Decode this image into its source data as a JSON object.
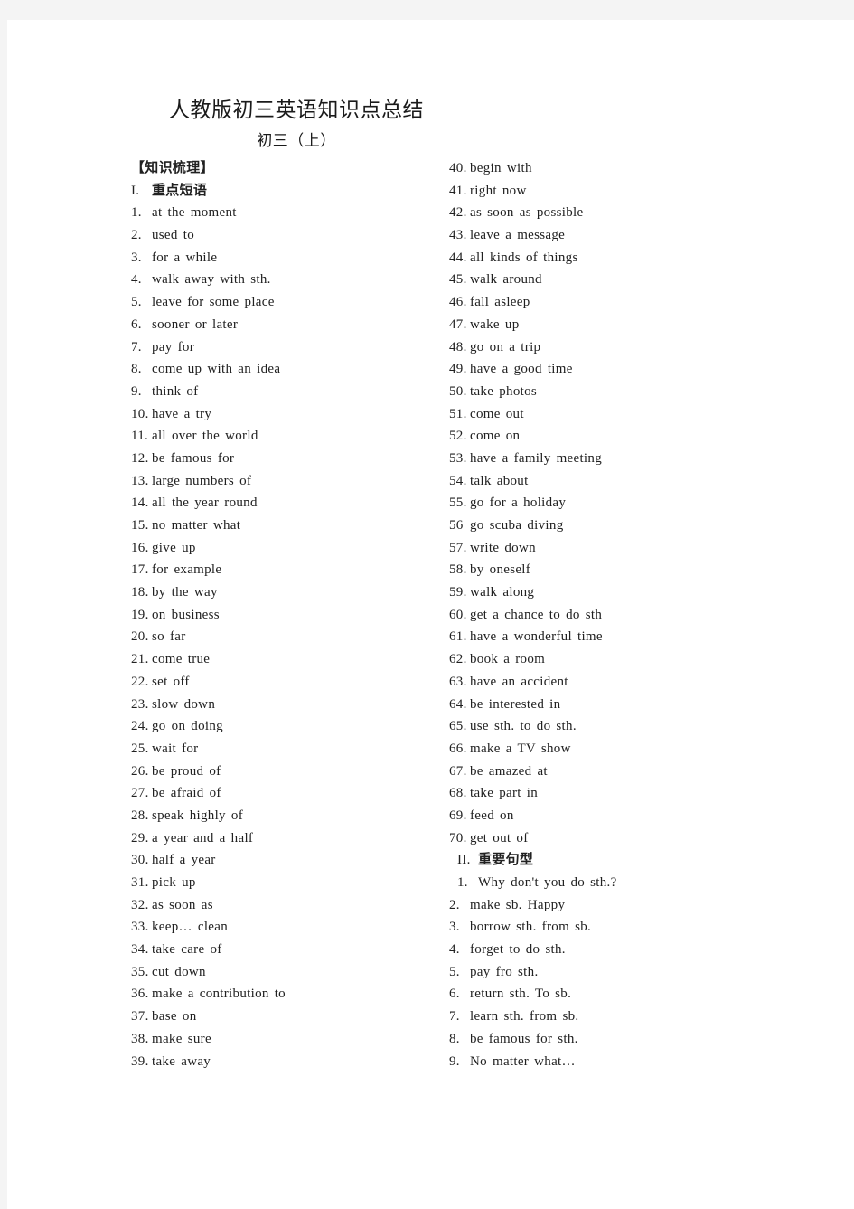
{
  "document": {
    "title": "人教版初三英语知识点总结",
    "subtitle": "初三（上）",
    "outline_heading": "【知识梳理】"
  },
  "sections": [
    {
      "number": "I.",
      "heading": "重点短语",
      "items": [
        {
          "num": "1.",
          "text": "at the moment"
        },
        {
          "num": "2.",
          "text": "used to"
        },
        {
          "num": "3.",
          "text": "for a while"
        },
        {
          "num": "4.",
          "text": "walk away with sth."
        },
        {
          "num": "5.",
          "text": "leave for some place"
        },
        {
          "num": "6.",
          "text": "sooner or later"
        },
        {
          "num": "7.",
          "text": "pay for"
        },
        {
          "num": "8.",
          "text": "come up with an idea"
        },
        {
          "num": "9.",
          "text": "think of"
        },
        {
          "num": "10.",
          "text": "have a try"
        },
        {
          "num": "11.",
          "text": "all over the world"
        },
        {
          "num": "12.",
          "text": "be famous for"
        },
        {
          "num": "13.",
          "text": "large numbers of"
        },
        {
          "num": "14.",
          "text": "all the year round"
        },
        {
          "num": "15.",
          "text": "no matter what"
        },
        {
          "num": "16.",
          "text": "give up"
        },
        {
          "num": "17.",
          "text": "for example"
        },
        {
          "num": "18.",
          "text": "by the way"
        },
        {
          "num": "19.",
          "text": "on business"
        },
        {
          "num": "20.",
          "text": "so far"
        },
        {
          "num": "21.",
          "text": "come true"
        },
        {
          "num": "22.",
          "text": "set off"
        },
        {
          "num": "23.",
          "text": "slow down"
        },
        {
          "num": "24.",
          "text": "go on doing"
        },
        {
          "num": "25.",
          "text": "wait for"
        },
        {
          "num": "26.",
          "text": "be proud of"
        },
        {
          "num": "27.",
          "text": "be afraid of"
        },
        {
          "num": "28.",
          "text": "speak highly of"
        },
        {
          "num": "29.",
          "text": "a year and a half"
        },
        {
          "num": "30.",
          "text": "half a year"
        },
        {
          "num": "31.",
          "text": "pick up"
        },
        {
          "num": "32.",
          "text": "as soon as"
        },
        {
          "num": "33.",
          "text": "keep… clean"
        },
        {
          "num": "34.",
          "text": "take care of"
        },
        {
          "num": "35.",
          "text": "cut down"
        },
        {
          "num": "36.",
          "text": "make a contribution to"
        },
        {
          "num": "37.",
          "text": "base on"
        },
        {
          "num": "38.",
          "text": "make sure"
        },
        {
          "num": "39.",
          "text": "take away"
        },
        {
          "num": "40.",
          "text": "begin with"
        },
        {
          "num": "41.",
          "text": "right now"
        },
        {
          "num": "42.",
          "text": "as soon as possible"
        },
        {
          "num": "43.",
          "text": "leave a message"
        },
        {
          "num": "44.",
          "text": "all kinds of things"
        },
        {
          "num": "45.",
          "text": "walk around"
        },
        {
          "num": "46.",
          "text": "fall asleep"
        },
        {
          "num": "47.",
          "text": "wake up"
        },
        {
          "num": "48.",
          "text": "go on a trip"
        },
        {
          "num": "49.",
          "text": "have a good time"
        },
        {
          "num": "50.",
          "text": "take photos"
        },
        {
          "num": "51.",
          "text": "come out"
        },
        {
          "num": "52.",
          "text": "come on"
        },
        {
          "num": "53.",
          "text": "have a family meeting"
        },
        {
          "num": "54.",
          "text": "talk about"
        },
        {
          "num": "55.",
          "text": "go for a holiday"
        },
        {
          "num": "56",
          "text": "go scuba diving"
        },
        {
          "num": "57.",
          "text": "write down"
        },
        {
          "num": "58.",
          "text": "by oneself"
        },
        {
          "num": "59.",
          "text": "walk along"
        },
        {
          "num": "60.",
          "text": "get a chance to do sth"
        },
        {
          "num": "61.",
          "text": "have a wonderful time"
        },
        {
          "num": "62.",
          "text": "book a room"
        },
        {
          "num": "63.",
          "text": "have an accident"
        },
        {
          "num": "64.",
          "text": "be interested in"
        },
        {
          "num": "65.",
          "text": "use sth. to do sth."
        },
        {
          "num": "66.",
          "text": "make a TV show"
        },
        {
          "num": "67.",
          "text": "be amazed at"
        },
        {
          "num": "68.",
          "text": "take part in"
        },
        {
          "num": "69.",
          "text": "feed on"
        },
        {
          "num": "70.",
          "text": "get out of"
        }
      ]
    },
    {
      "number": "II.",
      "heading": "重要句型",
      "items": [
        {
          "num": "1.",
          "text": "Why don't you do sth.?"
        },
        {
          "num": "2.",
          "text": "make sb. Happy"
        },
        {
          "num": "3.",
          "text": "borrow sth. from sb."
        },
        {
          "num": "4.",
          "text": "forget to do sth."
        },
        {
          "num": "5.",
          "text": "pay fro sth."
        },
        {
          "num": "6.",
          "text": "return sth. To sb."
        },
        {
          "num": "7.",
          "text": "learn sth. from sb."
        },
        {
          "num": "8.",
          "text": "be famous for sth."
        },
        {
          "num": "9.",
          "text": "No matter what…"
        }
      ]
    }
  ],
  "layout": {
    "left_column_last_item_index": 39,
    "text_color": "#212121"
  }
}
